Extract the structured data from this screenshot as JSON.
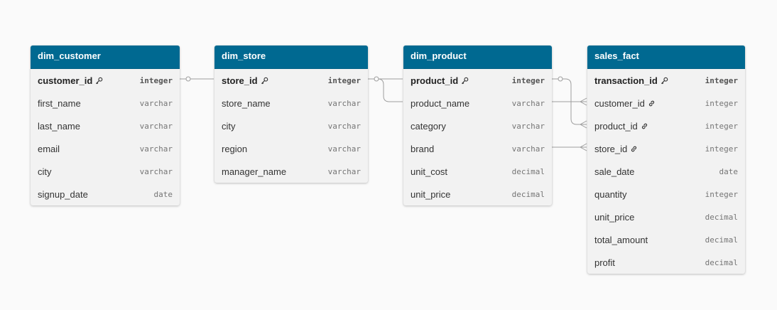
{
  "colors": {
    "header_bg": "#006991",
    "body_bg": "#f2f2f2",
    "canvas_bg": "#fafafa",
    "connector": "#9e9e9e"
  },
  "entities": [
    {
      "id": "dim_customer",
      "title": "dim_customer",
      "columns": [
        {
          "name": "customer_id",
          "type": "integer",
          "key": "pk",
          "icon": "key-icon"
        },
        {
          "name": "first_name",
          "type": "varchar"
        },
        {
          "name": "last_name",
          "type": "varchar"
        },
        {
          "name": "email",
          "type": "varchar"
        },
        {
          "name": "city",
          "type": "varchar"
        },
        {
          "name": "signup_date",
          "type": "date"
        }
      ]
    },
    {
      "id": "dim_store",
      "title": "dim_store",
      "columns": [
        {
          "name": "store_id",
          "type": "integer",
          "key": "pk",
          "icon": "key-icon"
        },
        {
          "name": "store_name",
          "type": "varchar"
        },
        {
          "name": "city",
          "type": "varchar"
        },
        {
          "name": "region",
          "type": "varchar"
        },
        {
          "name": "manager_name",
          "type": "varchar"
        }
      ]
    },
    {
      "id": "dim_product",
      "title": "dim_product",
      "columns": [
        {
          "name": "product_id",
          "type": "integer",
          "key": "pk",
          "icon": "key-icon"
        },
        {
          "name": "product_name",
          "type": "varchar"
        },
        {
          "name": "category",
          "type": "varchar"
        },
        {
          "name": "brand",
          "type": "varchar"
        },
        {
          "name": "unit_cost",
          "type": "decimal"
        },
        {
          "name": "unit_price",
          "type": "decimal"
        }
      ]
    },
    {
      "id": "sales_fact",
      "title": "sales_fact",
      "columns": [
        {
          "name": "transaction_id",
          "type": "integer",
          "key": "pk",
          "icon": "key-icon"
        },
        {
          "name": "customer_id",
          "type": "integer",
          "key": "fk",
          "icon": "link-icon"
        },
        {
          "name": "product_id",
          "type": "integer",
          "key": "fk",
          "icon": "link-icon"
        },
        {
          "name": "store_id",
          "type": "integer",
          "key": "fk",
          "icon": "link-icon"
        },
        {
          "name": "sale_date",
          "type": "date"
        },
        {
          "name": "quantity",
          "type": "integer"
        },
        {
          "name": "unit_price",
          "type": "decimal"
        },
        {
          "name": "total_amount",
          "type": "decimal"
        },
        {
          "name": "profit",
          "type": "decimal"
        }
      ]
    }
  ],
  "relationships": [
    {
      "from": "dim_customer.customer_id",
      "to": "sales_fact.customer_id",
      "from_cardinality": "one",
      "to_cardinality": "many"
    },
    {
      "from": "dim_product.product_id",
      "to": "sales_fact.product_id",
      "from_cardinality": "one",
      "to_cardinality": "many"
    },
    {
      "from": "dim_store.store_id",
      "to": "sales_fact.store_id",
      "from_cardinality": "one",
      "to_cardinality": "many"
    }
  ]
}
